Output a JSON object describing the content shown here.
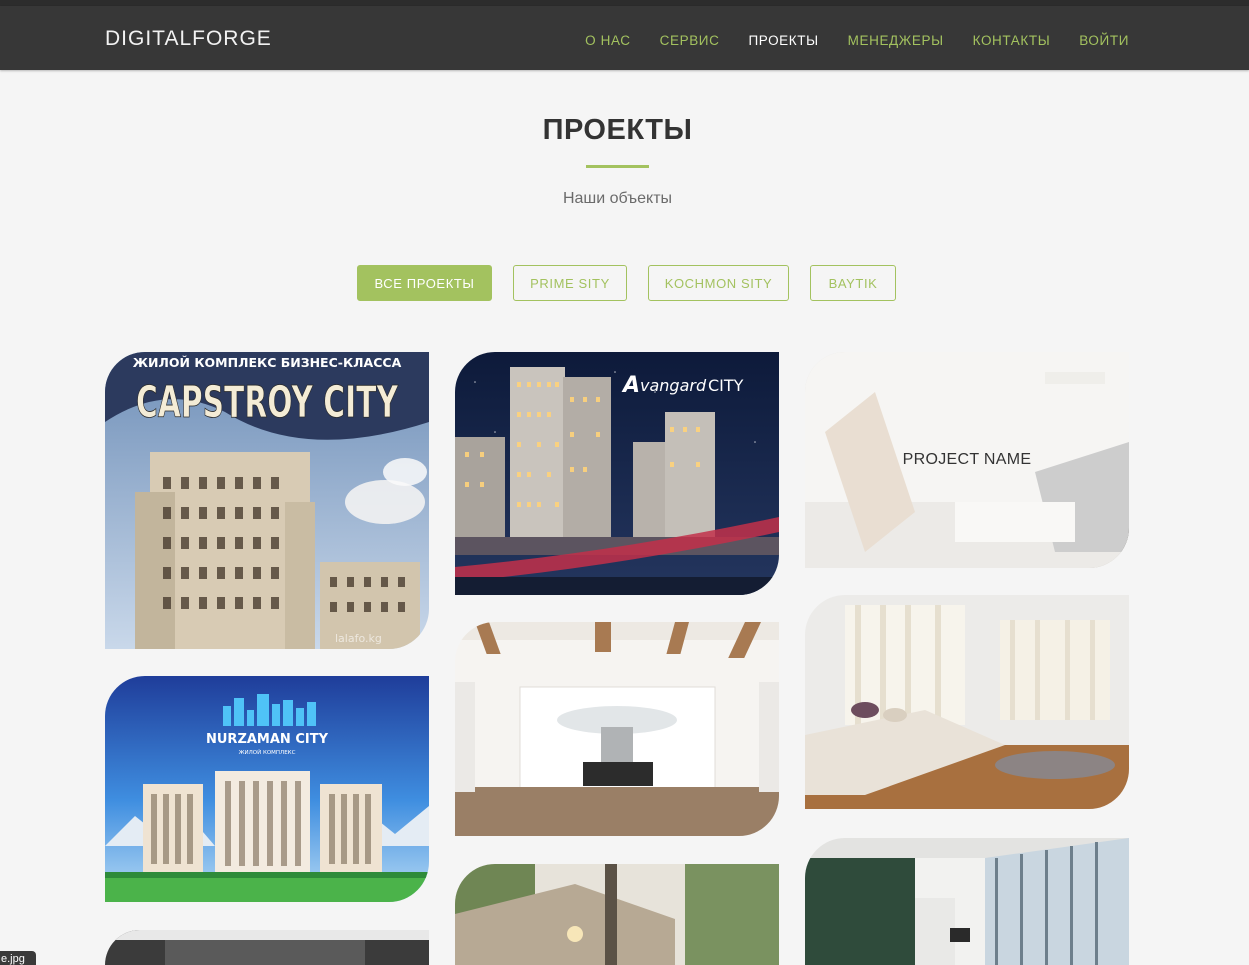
{
  "header": {
    "brand": "DIGITALFORGE",
    "nav": [
      "О НАС",
      "СЕРВИС",
      "ПРОЕКТЫ",
      "МЕНЕДЖЕРЫ",
      "КОНТАКТЫ",
      "ВОЙТИ"
    ],
    "active_nav": "ПРОЕКТЫ"
  },
  "section": {
    "title": "ПРОЕКТЫ",
    "subtitle": "Наши объекты"
  },
  "filters": [
    "ВСЕ ПРОЕКТЫ",
    "PRIME SITY",
    "KOCHMON SITY",
    "BAYTIK"
  ],
  "active_filter": "ВСЕ ПРОЕКТЫ",
  "projects": {
    "capstroy": {
      "top_text": "ЖИЛОЙ КОМПЛЕКС БИЗНЕС-КЛАССА",
      "name": "CAPSTROY CITY",
      "watermark": "lalafo.kg"
    },
    "avangard": {
      "name_a": "A",
      "name_rest": "vangard",
      "name_city": "CITY"
    },
    "hover": {
      "name": "PROJECT NAME"
    },
    "nurzaman": {
      "name": "NURZAMAN CITY",
      "subtitle": "ЖИЛОЙ КОМПЛЕКС"
    }
  },
  "tooltip": "e.jpg",
  "colors": {
    "accent": "#a3c25f",
    "header_bg": "#373737",
    "page_bg": "#f5f5f5"
  }
}
